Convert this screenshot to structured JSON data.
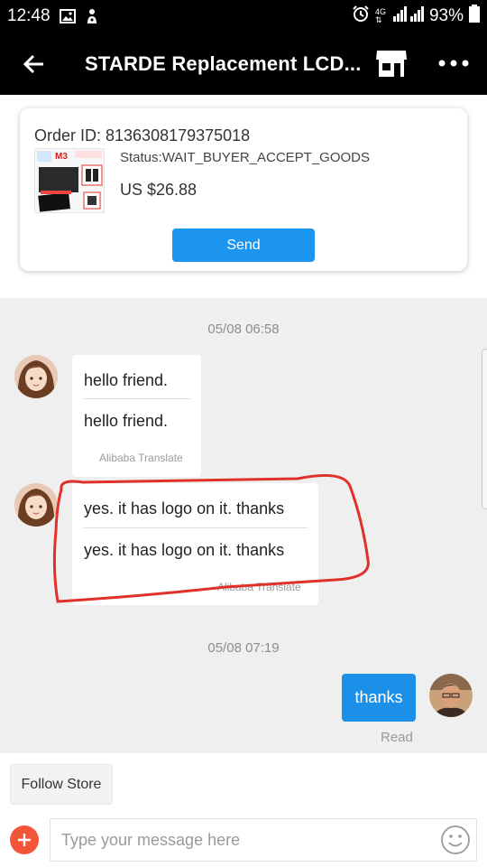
{
  "status_bar": {
    "time": "12:48",
    "network_top": "4G",
    "battery": "93%",
    "icons": [
      "image-icon",
      "notification-icon",
      "alarm-icon",
      "signal-icon",
      "battery-icon"
    ]
  },
  "header": {
    "title": "STARDE Replacement LCD...",
    "back_icon": "arrow-left-icon",
    "store_icon": "store-icon",
    "more_icon": "more-dots-icon"
  },
  "order": {
    "id_text": "Order ID: 8136308179375018",
    "status_text": "Status:WAIT_BUYER_ACCEPT_GOODS",
    "price_text": "US $26.88",
    "send_label": "Send",
    "thumb_text": "M3"
  },
  "chat": {
    "timestamp_1": "05/08 06:58",
    "message_1": {
      "original": "hello friend.",
      "translated": "hello friend.",
      "translator": "Alibaba Translate"
    },
    "message_2": {
      "original": "yes. it has logo on it. thanks",
      "translated": "yes. it has logo on it. thanks",
      "translator": "Alibaba Translate"
    },
    "timestamp_2": "05/08 07:19",
    "outgoing_message": "thanks",
    "read_label": "Read"
  },
  "footer": {
    "follow_store_label": "Follow Store",
    "input_placeholder": "Type your message here",
    "input_value": "",
    "plus_icon": "plus-icon",
    "emoji_icon": "smiley-icon"
  },
  "colors": {
    "accent_blue": "#1c95f0",
    "plus_red": "#f3553a",
    "annotation_red": "#e0302a",
    "chat_bg": "#efefef"
  }
}
